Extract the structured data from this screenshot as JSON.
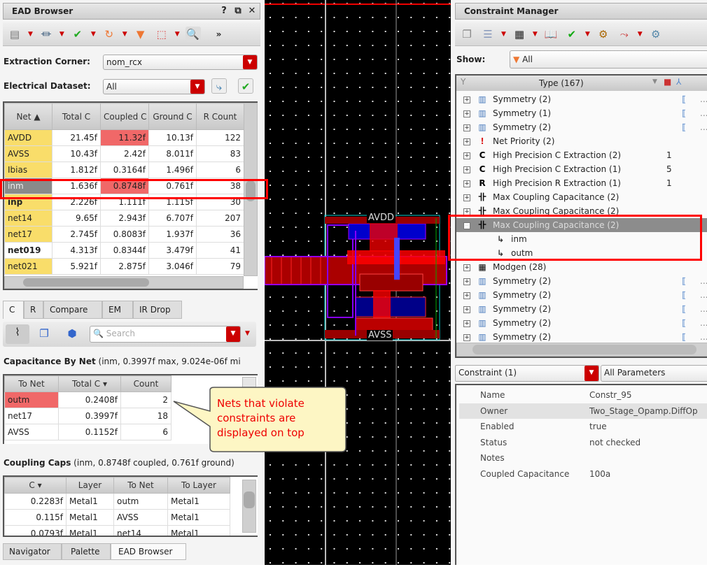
{
  "ead": {
    "title": "EAD Browser",
    "win_buttons": [
      "?",
      "⧉",
      "✕"
    ],
    "extraction_label": "Extraction Corner:",
    "extraction_value": "nom_rcx",
    "dataset_label": "Electrical Dataset:",
    "dataset_value": "All",
    "net_table": {
      "headers": [
        "Net ▲",
        "Total C",
        "Coupled C",
        "Ground C",
        "R Count"
      ],
      "rows": [
        [
          "AVDD",
          "21.45f",
          "11.32f",
          "10.13f",
          "122"
        ],
        [
          "AVSS",
          "10.43f",
          "2.42f",
          "8.011f",
          "83"
        ],
        [
          "Ibias",
          "1.812f",
          "0.3164f",
          "1.496f",
          "6"
        ],
        [
          "inm",
          "1.636f",
          "0.8748f",
          "0.761f",
          "38"
        ],
        [
          "inp",
          "2.226f",
          "1.111f",
          "1.115f",
          "30"
        ],
        [
          "net14",
          "9.65f",
          "2.943f",
          "6.707f",
          "207"
        ],
        [
          "net17",
          "2.745f",
          "0.8083f",
          "1.937f",
          "36"
        ],
        [
          "net019",
          "4.313f",
          "0.8344f",
          "3.479f",
          "41"
        ],
        [
          "net021",
          "5.921f",
          "2.875f",
          "3.046f",
          "79"
        ]
      ]
    },
    "tabs": [
      "C",
      "R",
      "Compare",
      "EM",
      "IR Drop"
    ],
    "search_placeholder": "Search",
    "cap_by_net_title": "Capacitance By Net",
    "cap_by_net_detail": " (inm, 0.3997f max, 9.024e-06f mi",
    "cap_table": {
      "headers": [
        "To Net",
        "Total C ▾",
        "Count"
      ],
      "rows": [
        [
          "outm",
          "0.2408f",
          "2"
        ],
        [
          "net17",
          "0.3997f",
          "18"
        ],
        [
          "AVSS",
          "0.1152f",
          "6"
        ]
      ]
    },
    "coupling_title": "Coupling Caps",
    "coupling_detail": " (inm, 0.8748f coupled, 0.761f ground)",
    "coupling_table": {
      "headers": [
        "C ▾",
        "Layer",
        "To Net",
        "To Layer"
      ],
      "rows": [
        [
          "0.2283f",
          "Metal1",
          "outm",
          "Metal1"
        ],
        [
          "0.115f",
          "Metal1",
          "AVSS",
          "Metal1"
        ],
        [
          "0.0793f",
          "Metal1",
          "net14",
          "Metal1"
        ]
      ]
    },
    "bottom_tabs": [
      "Navigator",
      "Palette",
      "EAD Browser"
    ]
  },
  "callout": "Nets that violate constraints are displayed on top",
  "canvas": {
    "labels": [
      "AVDD",
      "AVSS"
    ]
  },
  "cm": {
    "title": "Constraint Manager",
    "show_label": "Show:",
    "show_value": "All",
    "tree_header": "Type (167)",
    "rows": [
      {
        "icon": "symmetry",
        "label": "Symmetry (2)",
        "val": "",
        "dots": "..."
      },
      {
        "icon": "symmetry",
        "label": "Symmetry (1)",
        "val": "",
        "dots": "..."
      },
      {
        "icon": "symmetry",
        "label": "Symmetry (2)",
        "val": "",
        "dots": "..."
      },
      {
        "icon": "net-priority",
        "label": "Net Priority (2)",
        "val": "",
        "dots": ""
      },
      {
        "icon": "hp-c",
        "label": "High Precision C Extraction (2)",
        "val": "1",
        "dots": ""
      },
      {
        "icon": "hp-c",
        "label": "High Precision C Extraction (1)",
        "val": "5",
        "dots": ""
      },
      {
        "icon": "hp-r",
        "label": "High Precision R Extraction (1)",
        "val": "1",
        "dots": ""
      },
      {
        "icon": "max-coupling",
        "label": "Max Coupling Capacitance (2)",
        "val": "",
        "dots": ""
      },
      {
        "icon": "max-coupling",
        "label": "Max Coupling Capacitance (2)",
        "val": "",
        "dots": ""
      },
      {
        "icon": "max-coupling",
        "label": "Max Coupling Capacitance (2)",
        "val": "",
        "dots": "",
        "selected": true
      },
      {
        "icon": "net",
        "label": "inm",
        "child": true
      },
      {
        "icon": "net",
        "label": "outm",
        "child": true
      },
      {
        "icon": "modgen",
        "label": "Modgen (28)",
        "val": "",
        "dots": ""
      },
      {
        "icon": "symmetry",
        "label": "Symmetry (2)",
        "val": "",
        "dots": "..."
      },
      {
        "icon": "symmetry",
        "label": "Symmetry (2)",
        "val": "",
        "dots": "..."
      },
      {
        "icon": "symmetry",
        "label": "Symmetry (2)",
        "val": "",
        "dots": "..."
      },
      {
        "icon": "symmetry",
        "label": "Symmetry (2)",
        "val": "",
        "dots": "..."
      },
      {
        "icon": "symmetry",
        "label": "Symmetry (2)",
        "val": "",
        "dots": "..."
      }
    ],
    "constraint_select": "Constraint (1)",
    "param_select": "All Parameters",
    "props": [
      [
        "Name",
        "Constr_95"
      ],
      [
        "Owner",
        "Two_Stage_Opamp.DiffOp"
      ],
      [
        "Enabled",
        "true"
      ],
      [
        "Status",
        "not checked"
      ],
      [
        "Notes",
        ""
      ],
      [
        "Coupled Capacitance",
        "100a"
      ]
    ]
  },
  "colors": {
    "highlight": "#ff0000",
    "violation": "#f06868",
    "net_yellow": "#f9dd6a"
  }
}
